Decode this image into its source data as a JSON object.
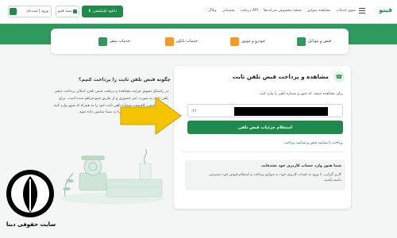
{
  "header": {
    "brand": "فینو",
    "links": [
      "منوی خدمات",
      "مشاهده سوابق",
      "نسخه مخصوص شرکت‌ها",
      "دریافت API",
      "پشتیبانی",
      "وبلاگ"
    ],
    "app_button": "دانلود اپلیکیشن",
    "wallet_button": "سبد فینو",
    "login_button": "ورود | ثبت‌نام"
  },
  "categories": [
    {
      "label": "قبض و موبایل",
      "color": "#2e9a5d"
    },
    {
      "label": "خودرو و موتور",
      "color": "#f59a23"
    },
    {
      "label": "خدمات بانکی",
      "color": "#f59a23"
    },
    {
      "label": "خدمات سفر",
      "color": "#2e9a5d"
    }
  ],
  "card": {
    "title": "مشاهده و پرداخت قبض تلفن ثابت",
    "subtitle": "برای مشاهده نتیجه، کد شهر و شماره تلفن را وارد کنید.",
    "prefix": "۰۲۱",
    "submit": "استعلام جزئیات قبض تلفن",
    "link": "پرداخت با شناسه قبض و شناسه پرداخت",
    "notice_title": "شما هنوز وارد حساب کاربری خود نشده‌اید.",
    "notice_text": "کاربر گرامی، با ورود به حساب کاربری خود، به سوابق پرداخت و استعلام قبوض خود دسترسی داشته باشید."
  },
  "help": {
    "title": "چگونه قبض تلفن ثابت را پرداخت کنیم؟",
    "text": "در راستای تسهیل فرایند مشاهده و دریافت قبض تلفن، امکان پرداخت بدهی تلفن ثابت به صورت غیر حضوری و از طریق فینو فراهم شده است. برای مشاهده قبض، کافیست شماره تلفن ثابت خود را به همراه کد شهر وارد کنید. جزئیات قبض میاندوره و پایان‌دوره به شما نمایش داده شود."
  },
  "logo": {
    "text": "سایت حقوقی دینا"
  },
  "colors": {
    "accent": "#1f8a4c",
    "hero": "#2e9a5d",
    "arrow": "#f5c400"
  }
}
